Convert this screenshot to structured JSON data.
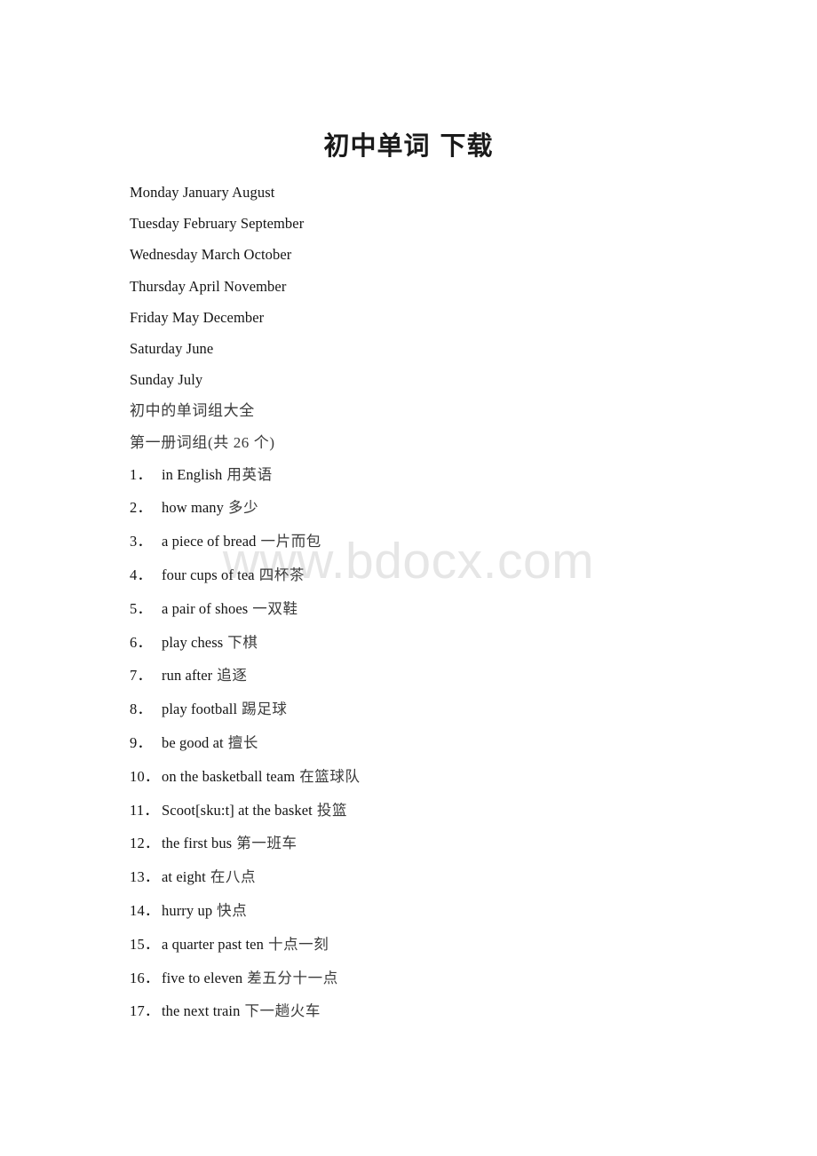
{
  "document": {
    "title": "初中单词 下载",
    "watermark": "www.bdocx.com"
  },
  "schedule_lines": [
    "Monday January August",
    "Tuesday February September",
    "Wednesday March October",
    "Thursday April November",
    "Friday May December",
    "Saturday June",
    "Sunday July"
  ],
  "section_headings": [
    "初中的单词组大全",
    "第一册词组(共 26 个)"
  ],
  "phrases": [
    {
      "num": "1．",
      "en": "in English",
      "zh": "用英语"
    },
    {
      "num": "2．",
      "en": "how many",
      "zh": "多少"
    },
    {
      "num": "3．",
      "en": "a piece of bread",
      "zh": "一片而包"
    },
    {
      "num": "4．",
      "en": "four cups of tea",
      "zh": "四杯茶"
    },
    {
      "num": "5．",
      "en": "a pair of shoes",
      "zh": "一双鞋"
    },
    {
      "num": "6．",
      "en": "play chess",
      "zh": "下棋"
    },
    {
      "num": "7．",
      "en": "run after",
      "zh": "追逐"
    },
    {
      "num": "8．",
      "en": "play football",
      "zh": "踢足球"
    },
    {
      "num": "9．",
      "en": "be good at",
      "zh": "擅长"
    },
    {
      "num": "10．",
      "en": "on the basketball team",
      "zh": "在篮球队"
    },
    {
      "num": "11．",
      "en": "Scoot[sku:t] at the basket",
      "zh": "投篮"
    },
    {
      "num": "12．",
      "en": "the first bus",
      "zh": "第一班车"
    },
    {
      "num": "13．",
      "en": "at eight",
      "zh": "在八点"
    },
    {
      "num": "14．",
      "en": "hurry up",
      "zh": "快点"
    },
    {
      "num": "15．",
      "en": "a quarter past ten",
      "zh": "十点一刻"
    },
    {
      "num": "16．",
      "en": "five to eleven",
      "zh": "差五分十一点"
    },
    {
      "num": "17．",
      "en": "the next train",
      "zh": "下一趟火车"
    }
  ]
}
